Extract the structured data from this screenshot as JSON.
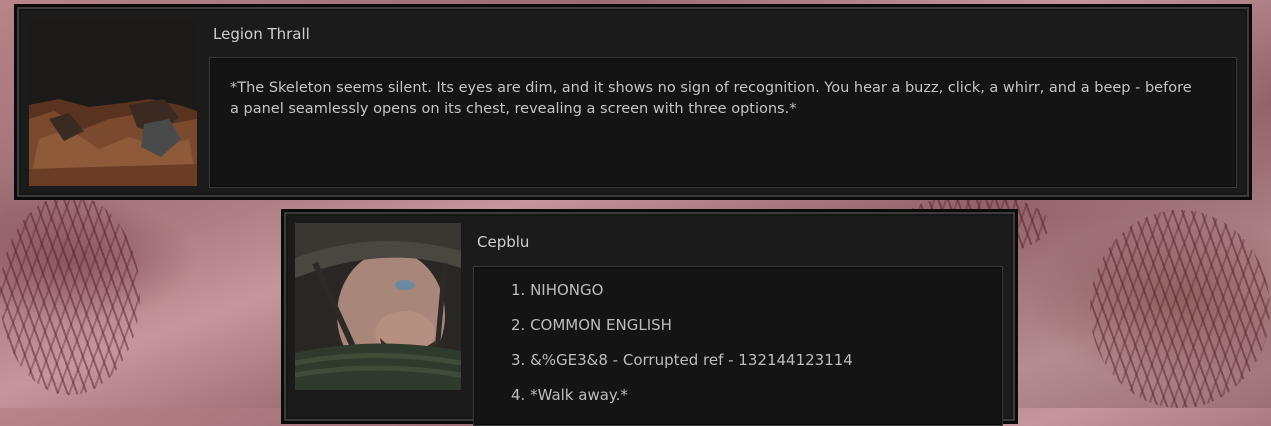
{
  "npc_dialog": {
    "speaker": "Legion Thrall",
    "text": "*The Skeleton seems silent. Its eyes are dim, and it shows no sign of recognition. You hear a buzz, click, a whirr, and a beep - before a panel seamlessly opens on its chest, revealing a screen with three options.*"
  },
  "player_dialog": {
    "speaker": "Cepblu",
    "options": [
      {
        "label": "1. NIHONGO"
      },
      {
        "label": "2. COMMON ENGLISH"
      },
      {
        "label": "3. &%GE3&8 - Corrupted ref - 132144123114"
      },
      {
        "label": "4. *Walk away.*"
      }
    ]
  }
}
